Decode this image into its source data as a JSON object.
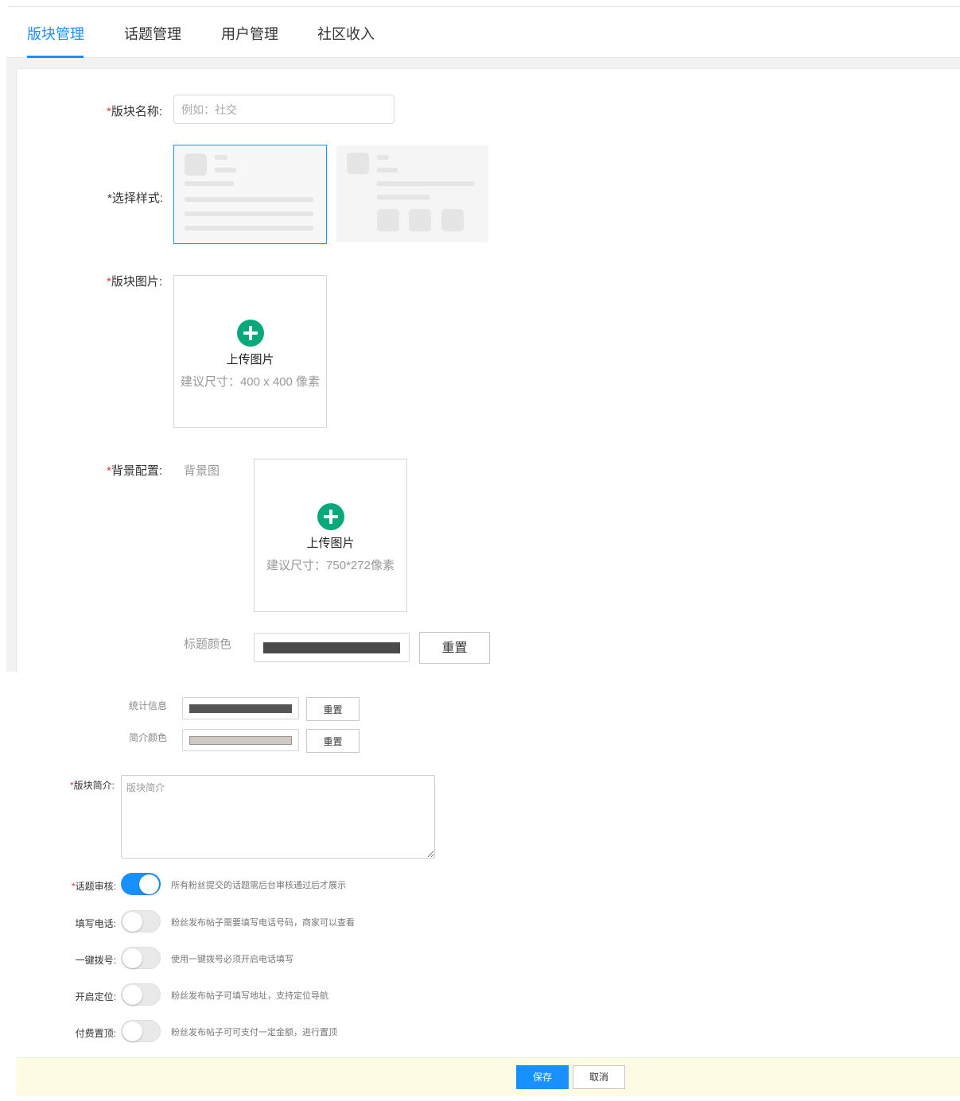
{
  "tabs": [
    {
      "label": "版块管理",
      "active": true
    },
    {
      "label": "话题管理",
      "active": false
    },
    {
      "label": "用户管理",
      "active": false
    },
    {
      "label": "社区收入",
      "active": false
    }
  ],
  "form": {
    "required_mark": "*",
    "name": {
      "label": "版块名称:",
      "placeholder": "例如：社交",
      "value": ""
    },
    "style": {
      "label": "*选择样式:",
      "selected_index": 0
    },
    "image": {
      "label": "版块图片:",
      "upload_title": "上传图片",
      "upload_hint": "建议尺寸：400 x 400 像素"
    },
    "background": {
      "label": "背景配置:",
      "bg_label": "背景图",
      "upload_title": "上传图片",
      "upload_hint": "建议尺寸：750*272像素",
      "title_color": {
        "label": "标题颜色",
        "color": "#4a4a4a",
        "reset_label": "重置"
      },
      "stats_info": {
        "label": "统计信息",
        "color": "#555555",
        "reset_label": "重置"
      },
      "intro_color": {
        "label": "简介颜色",
        "color": "#d1c8c4",
        "reset_label": "重置"
      }
    },
    "intro": {
      "label": "版块简介:",
      "placeholder": "版块简介",
      "value": ""
    },
    "toggles": [
      {
        "label": "话题审核:",
        "required": true,
        "on": true,
        "desc": "所有粉丝提交的话题需后台审核通过后才展示"
      },
      {
        "label": "填写电话:",
        "required": false,
        "on": false,
        "desc": "粉丝发布帖子需要填写电话号码，商家可以查看"
      },
      {
        "label": "一键拨号:",
        "required": false,
        "on": false,
        "desc": "使用一键拨号必须开启电话填写"
      },
      {
        "label": "开启定位:",
        "required": false,
        "on": false,
        "desc": "粉丝发布帖子可填写地址，支持定位导航"
      },
      {
        "label": "付费置顶:",
        "required": false,
        "on": false,
        "desc": "粉丝发布帖子可可支付一定金额，进行置顶"
      }
    ]
  },
  "footer": {
    "save_label": "保存",
    "cancel_label": "取消"
  },
  "colors": {
    "accent": "#1890ff",
    "required": "#e4393c",
    "upload_plus": "#07a87c",
    "footer_bg": "#fdfbe3"
  }
}
